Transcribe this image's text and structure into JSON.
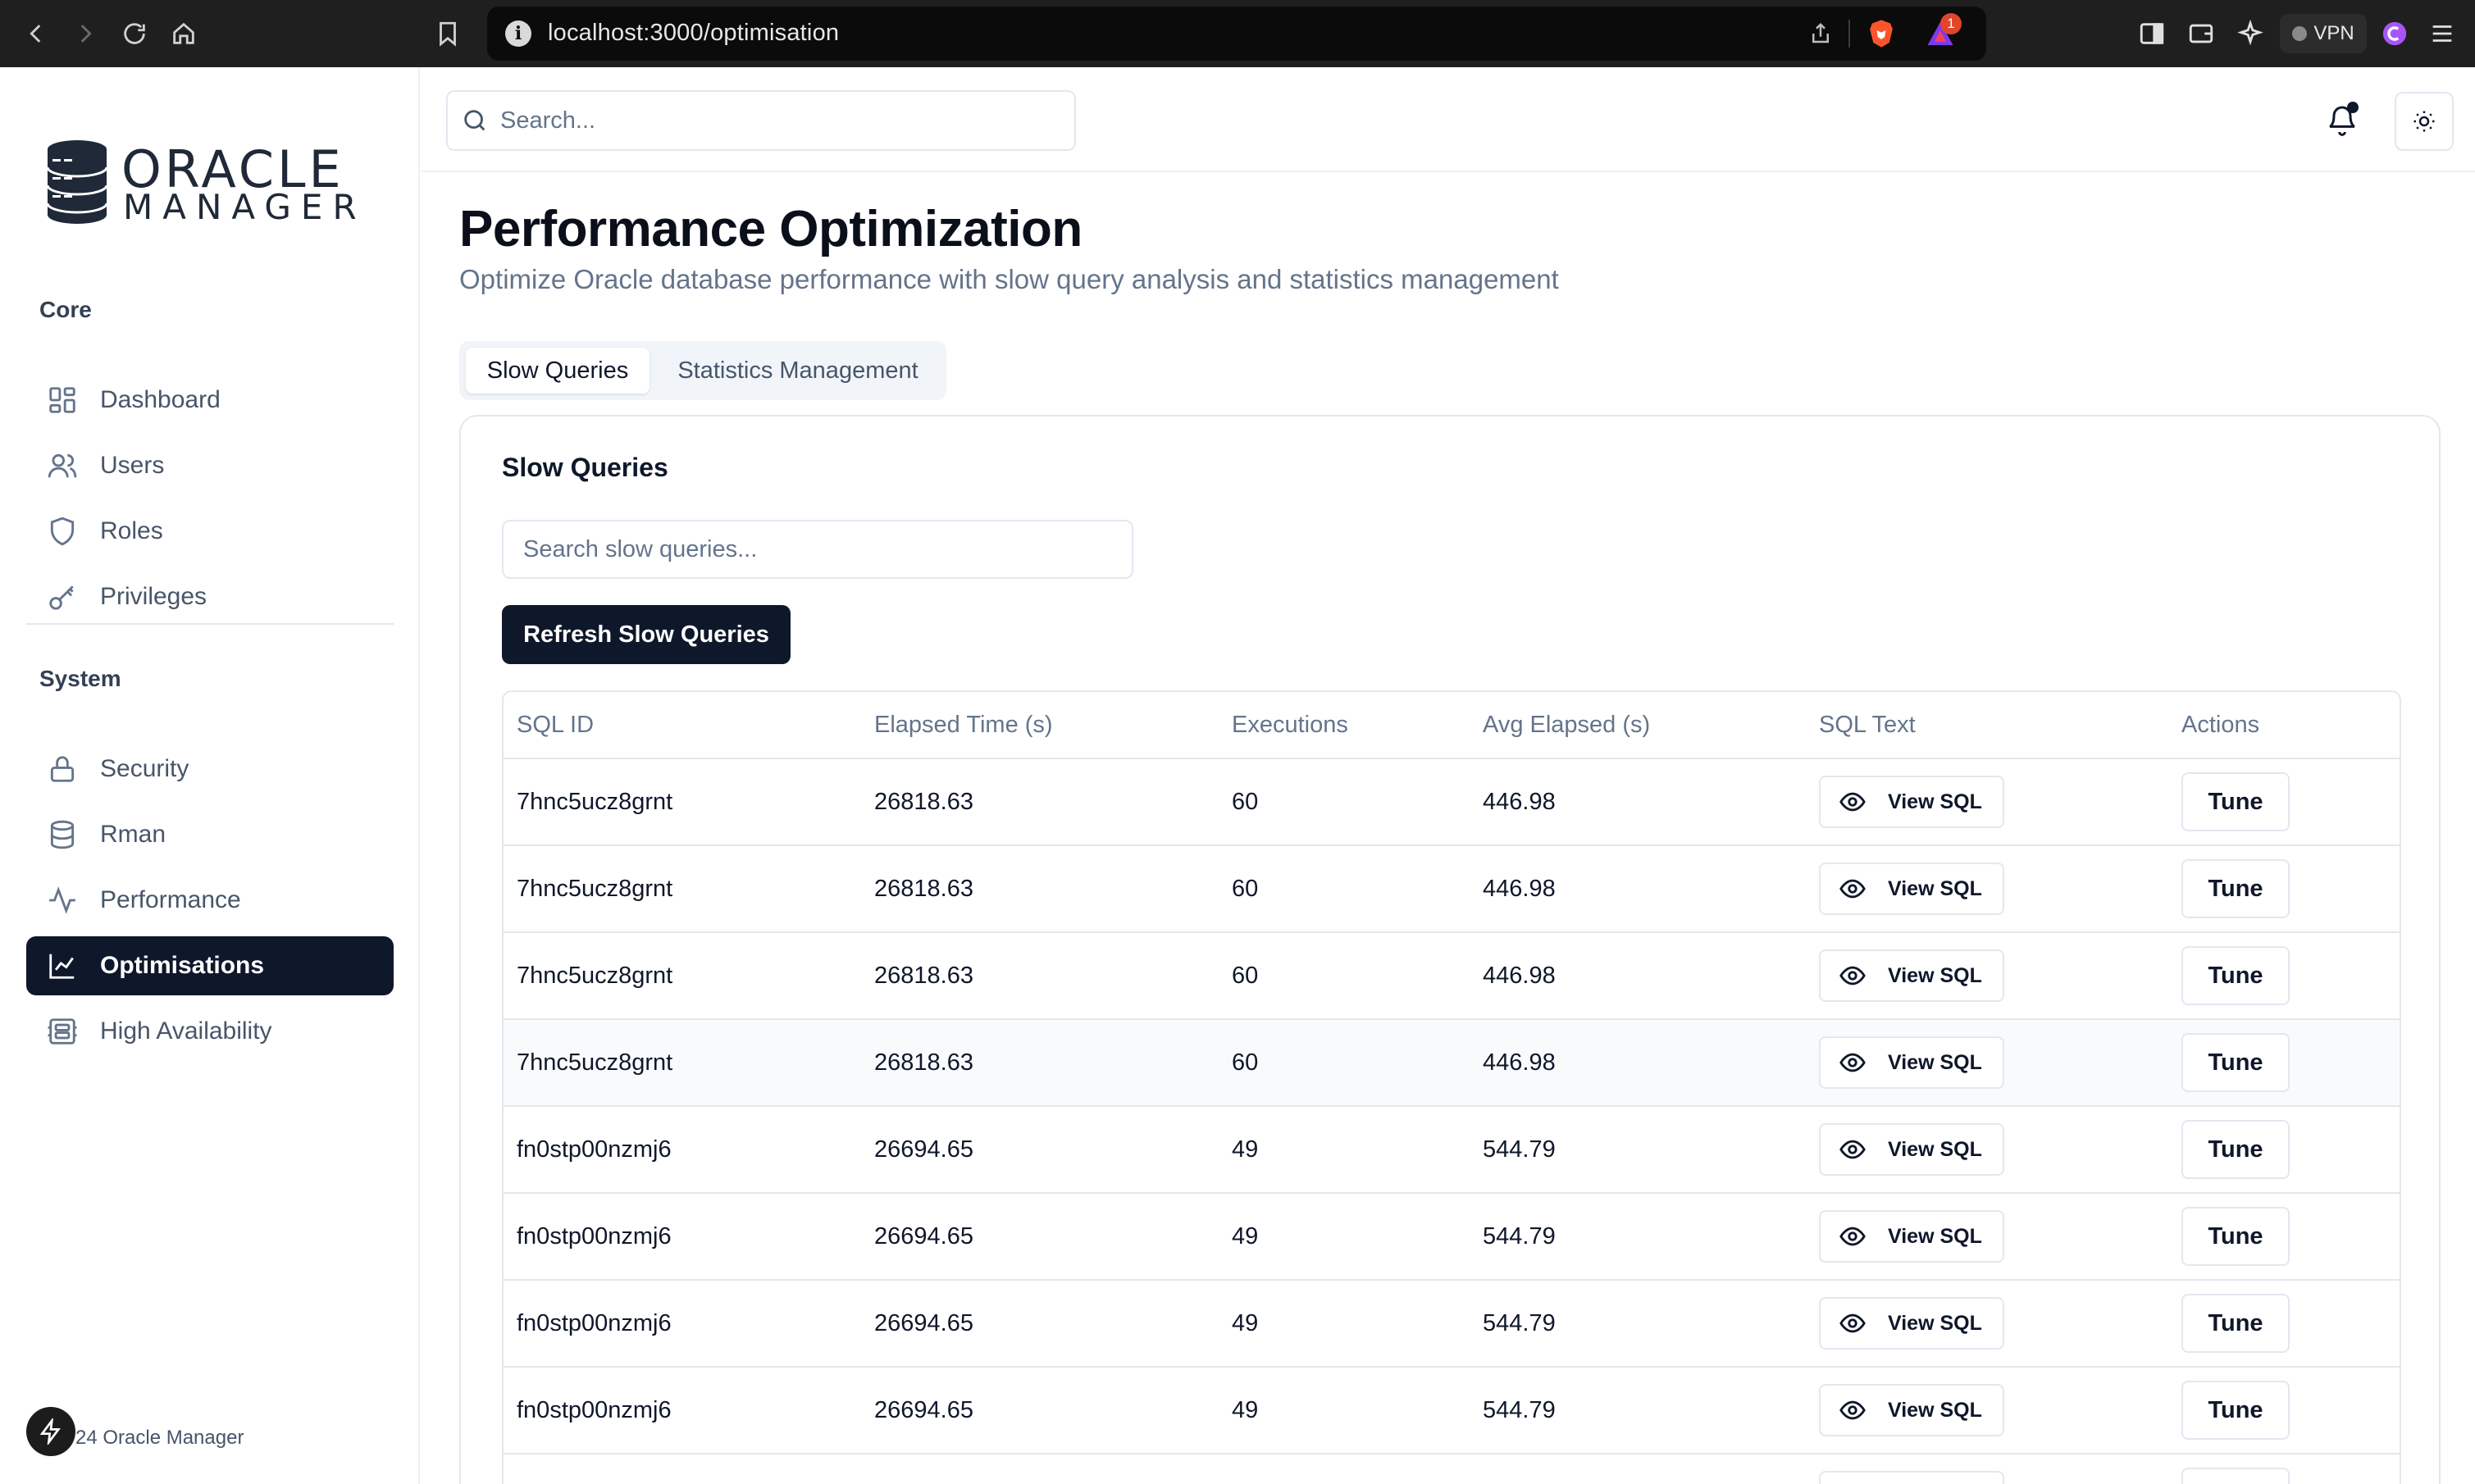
{
  "browser": {
    "url": "localhost:3000/optimisation",
    "vpn_label": "VPN",
    "notification_count": "1"
  },
  "app": {
    "brand_line1": "ORACLE",
    "brand_line2": "MANAGER",
    "footer": "24 Oracle Manager"
  },
  "topbar": {
    "search_placeholder": "Search..."
  },
  "sidebar": {
    "sections": [
      {
        "label": "Core",
        "items": [
          {
            "label": "Dashboard",
            "icon": "dashboard-icon"
          },
          {
            "label": "Users",
            "icon": "users-icon"
          },
          {
            "label": "Roles",
            "icon": "shield-icon"
          },
          {
            "label": "Privileges",
            "icon": "key-icon"
          }
        ]
      },
      {
        "label": "System",
        "items": [
          {
            "label": "Security",
            "icon": "lock-icon"
          },
          {
            "label": "Rman",
            "icon": "database-icon"
          },
          {
            "label": "Performance",
            "icon": "activity-icon"
          },
          {
            "label": "Optimisations",
            "icon": "line-chart-icon",
            "active": true
          },
          {
            "label": "High Availability",
            "icon": "server-icon"
          }
        ]
      }
    ]
  },
  "main": {
    "title": "Performance Optimization",
    "subtitle": "Optimize Oracle database performance with slow query analysis and statistics management",
    "tabs": [
      {
        "label": "Slow Queries",
        "active": true
      },
      {
        "label": "Statistics Management",
        "active": false
      }
    ],
    "card": {
      "title": "Slow Queries",
      "search_placeholder": "Search slow queries...",
      "refresh_label": "Refresh Slow Queries",
      "columns": [
        "SQL ID",
        "Elapsed Time (s)",
        "Executions",
        "Avg Elapsed (s)",
        "SQL Text",
        "Actions"
      ],
      "view_label": "View SQL",
      "tune_label": "Tune",
      "rows": [
        {
          "sql_id": "7hnc5ucz8grnt",
          "elapsed": "26818.63",
          "executions": "60",
          "avg": "446.98"
        },
        {
          "sql_id": "7hnc5ucz8grnt",
          "elapsed": "26818.63",
          "executions": "60",
          "avg": "446.98"
        },
        {
          "sql_id": "7hnc5ucz8grnt",
          "elapsed": "26818.63",
          "executions": "60",
          "avg": "446.98"
        },
        {
          "sql_id": "7hnc5ucz8grnt",
          "elapsed": "26818.63",
          "executions": "60",
          "avg": "446.98",
          "highlight": true
        },
        {
          "sql_id": "fn0stp00nzmj6",
          "elapsed": "26694.65",
          "executions": "49",
          "avg": "544.79"
        },
        {
          "sql_id": "fn0stp00nzmj6",
          "elapsed": "26694.65",
          "executions": "49",
          "avg": "544.79"
        },
        {
          "sql_id": "fn0stp00nzmj6",
          "elapsed": "26694.65",
          "executions": "49",
          "avg": "544.79"
        },
        {
          "sql_id": "fn0stp00nzmj6",
          "elapsed": "26694.65",
          "executions": "49",
          "avg": "544.79"
        },
        {
          "sql_id": "",
          "elapsed": "",
          "executions": "",
          "avg": ""
        }
      ]
    }
  },
  "colors": {
    "accent_dark": "#0f172a",
    "muted_text": "#64748b",
    "border": "#e5e7eb",
    "brave_orange": "#fb542b"
  }
}
